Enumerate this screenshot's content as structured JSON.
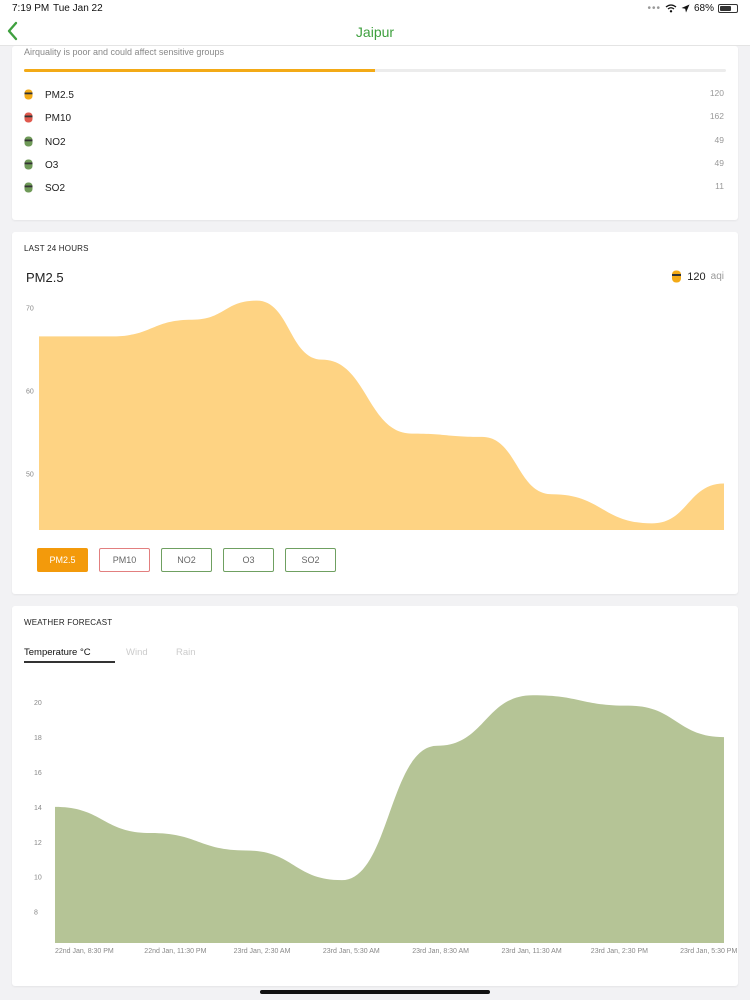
{
  "status_bar": {
    "time": "7:19 PM",
    "date": "Tue Jan 22",
    "battery": "68%",
    "icons": [
      "wifi-icon",
      "location-icon",
      "battery-icon"
    ]
  },
  "nav": {
    "title": "Jaipur",
    "back_icon": "chevron-left-icon",
    "title_color": "#3fa03f"
  },
  "aqi_summary": {
    "description": "Airquality is poor and could affect sensitive groups",
    "progress_fraction": 0.5,
    "progress_color": "#f3aa16",
    "pollutants": [
      {
        "name": "PM2.5",
        "value": "120",
        "face_color": "#f3aa16"
      },
      {
        "name": "PM10",
        "value": "162",
        "face_color": "#e05a4e"
      },
      {
        "name": "NO2",
        "value": "49",
        "face_color": "#6f9a58"
      },
      {
        "name": "O3",
        "value": "49",
        "face_color": "#6f9a58"
      },
      {
        "name": "SO2",
        "value": "11",
        "face_color": "#6f9a58"
      }
    ]
  },
  "last24": {
    "section_title": "LAST 24 HOURS",
    "pollutant": "PM2.5",
    "aqi_value": "120",
    "aqi_unit": "aqi",
    "buttons": [
      {
        "label": "PM2.5",
        "state": "active"
      },
      {
        "label": "PM10",
        "state": "red"
      },
      {
        "label": "NO2",
        "state": "normal"
      },
      {
        "label": "O3",
        "state": "normal"
      },
      {
        "label": "SO2",
        "state": "normal"
      }
    ]
  },
  "weather": {
    "section_title": "WEATHER FORECAST",
    "tabs": [
      {
        "label": "Temperature °C",
        "active": true
      },
      {
        "label": "Wind",
        "active": false
      },
      {
        "label": "Rain",
        "active": false
      }
    ]
  },
  "chart_data": [
    {
      "type": "area",
      "title": "PM2.5",
      "color": "#fed383",
      "ylim": [
        43.2,
        71
      ],
      "y_ticks": [
        70,
        60,
        50
      ],
      "x": [
        0,
        1,
        2,
        3,
        4,
        5,
        6,
        7,
        8
      ],
      "values": [
        66.5,
        66.5,
        68.5,
        70.8,
        63.7,
        54.8,
        54.4,
        47.5,
        44.0,
        48.8
      ],
      "x_positions_note": ""
    },
    {
      "type": "area",
      "title": "Temperature °C",
      "color": "#b5c496",
      "ylim": [
        6.2,
        21.5
      ],
      "y_ticks": [
        20,
        18,
        16,
        14,
        12,
        10,
        8
      ],
      "categories": [
        "22nd Jan, 8:30 PM",
        "22nd Jan, 11:30 PM",
        "23rd Jan, 2:30 AM",
        "23rd Jan, 5:30 AM",
        "23rd Jan, 8:30 AM",
        "23rd Jan, 11:30 AM",
        "23rd Jan, 2:30 PM",
        "23rd Jan, 5:30 PM"
      ],
      "values": [
        14.0,
        12.5,
        11.5,
        9.8,
        17.5,
        20.4,
        19.8,
        18.0
      ]
    }
  ]
}
